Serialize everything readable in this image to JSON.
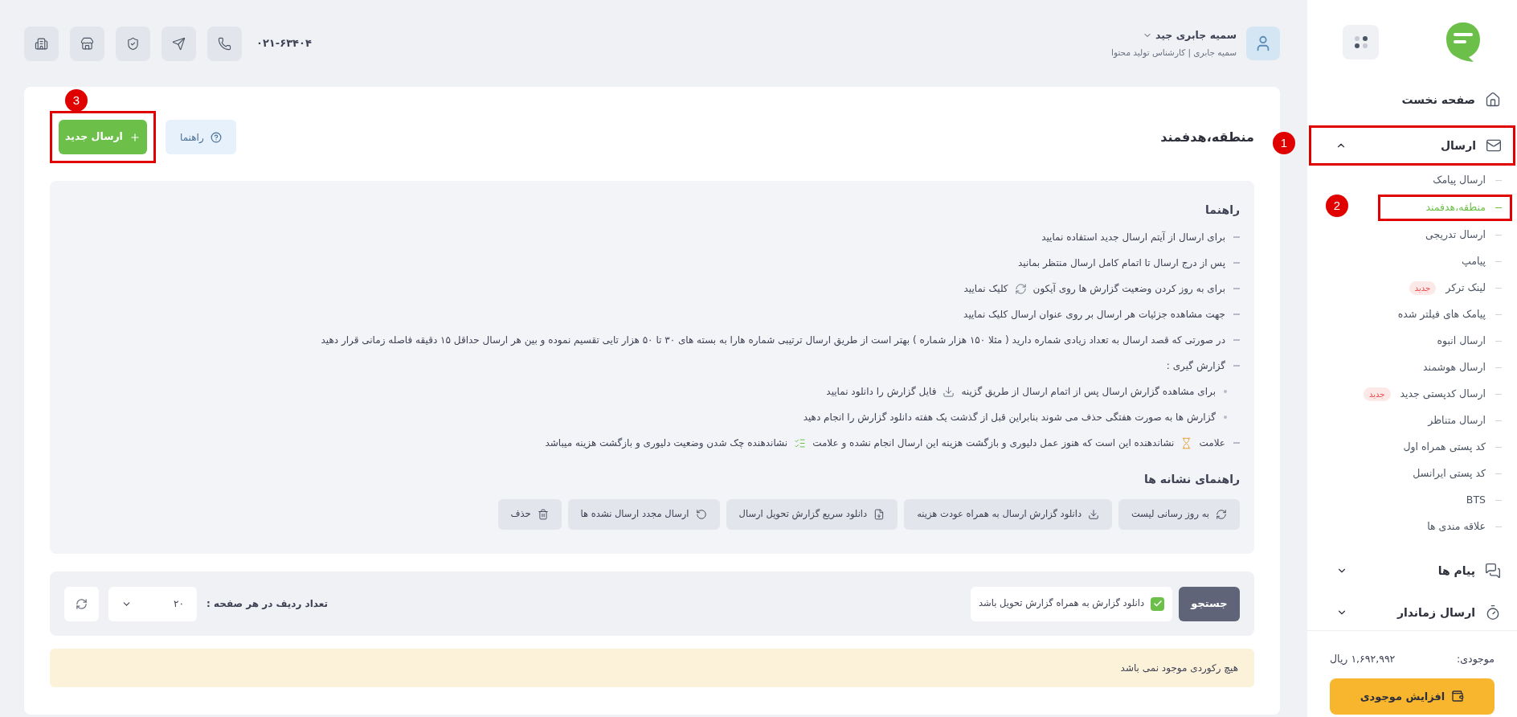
{
  "header": {
    "user": {
      "name": "سمیه جابری جید",
      "subtitle": "سمیه جابری | کارشناس تولید محتوا"
    },
    "phone": "۰۲۱-۶۳۴۰۴",
    "tools": [
      {
        "kind": "phone"
      },
      {
        "kind": "send"
      },
      {
        "kind": "shield"
      },
      {
        "kind": "store"
      },
      {
        "kind": "building"
      }
    ]
  },
  "page": {
    "title": "منطقه،هدفمند",
    "help_button": "راهنما",
    "new_button": {
      "label": "ارسال جدید",
      "annotation": "3"
    }
  },
  "guide": {
    "title": "راهنما",
    "items": [
      {
        "parts": [
          {
            "text": "برای ارسال از آیتم ارسال جدید استفاده نمایید"
          }
        ]
      },
      {
        "parts": [
          {
            "text": "پس از درج ارسال تا اتمام کامل ارسال منتظر بمانید"
          }
        ]
      },
      {
        "parts": [
          {
            "text": "برای به روز کردن وضعیت گزارش ها روی آیکون"
          },
          {
            "kind": "refresh"
          },
          {
            "text": "کلیک نمایید"
          }
        ]
      },
      {
        "parts": [
          {
            "text": "جهت مشاهده جزئیات هر ارسال بر روی عنوان ارسال کلیک نمایید"
          }
        ]
      },
      {
        "parts": [
          {
            "text": "در صورتی که قصد ارسال به تعداد زیادی شماره دارید ( مثلا ۱۵۰ هزار شماره ) بهتر است  از طریق ارسال ترتیبی شماره هارا به بسته های ۳۰ تا ۵۰ هزار تایی تقسیم نموده و بین هر ارسال حداقل ۱۵ دقیقه فاصله زمانی قرار دهید"
          }
        ]
      },
      {
        "parts": [
          {
            "text": "گزارش گیری :"
          }
        ],
        "children": [
          {
            "parts": [
              {
                "text": "برای مشاهده گزارش ارسال پس از اتمام ارسال از طریق گزینه"
              },
              {
                "kind": "download"
              },
              {
                "text": "فایل گزارش را دانلود نمایید"
              }
            ]
          },
          {
            "parts": [
              {
                "text": "گزارش ها به صورت هفتگی حذف می شوند بنابراین قبل از گذشت یک هفته دانلود گزارش را انجام دهید"
              }
            ]
          }
        ]
      },
      {
        "parts": [
          {
            "text": "علامت"
          },
          {
            "kind": "hourglass"
          },
          {
            "text": "نشاندهنده این است که هنوز عمل دلیوری و بازگشت هزینه این ارسال انجام نشده و علامت"
          },
          {
            "kind": "checklist"
          },
          {
            "text": "نشاندهنده چک شدن وضعیت دلیوری و بازگشت هزینه میباشد"
          }
        ]
      }
    ],
    "legend_title": "راهنمای نشانه ها",
    "legend": [
      {
        "kind": "refresh",
        "label": "به روز رسانی لیست"
      },
      {
        "kind": "download",
        "label": "دانلود گزارش ارسال به همراه عودت هزینه"
      },
      {
        "kind": "filedown",
        "label": "دانلود سریع گزارش تحویل ارسال"
      },
      {
        "kind": "retry",
        "label": "ارسال مجدد ارسال نشده ها"
      },
      {
        "kind": "trash",
        "label": "حذف"
      }
    ]
  },
  "filter": {
    "search_button": "جستجو",
    "checkbox": {
      "label": "دانلود گزارش به همراه گزارش تحویل باشد",
      "checked": true
    },
    "rows_label": "تعداد ردیف در هر صفحه :",
    "rows_value": "۲۰"
  },
  "alert": "هیچ رکوردی موجود نمی باشد",
  "sidebar": {
    "items": [
      {
        "kind": "home",
        "label": "صفحه نخست"
      },
      {
        "kind": "mail",
        "label": "ارسال",
        "expanded": true,
        "annotation": "1",
        "children": [
          {
            "label": "ارسال پیامک",
            "selected": false
          },
          {
            "label": "منطقه،هدفمند",
            "selected": true,
            "annotation": "2"
          },
          {
            "label": "ارسال تدریجی",
            "selected": false
          },
          {
            "label": "پیامپ",
            "selected": false
          },
          {
            "label": "لینک ترکر",
            "selected": false,
            "badge": "جدید"
          },
          {
            "label": "پیامک های فیلتر شده",
            "selected": false
          },
          {
            "label": "ارسال انبوه",
            "selected": false
          },
          {
            "label": "ارسال هوشمند",
            "selected": false
          },
          {
            "label": "ارسال کدپستی جدید",
            "selected": false,
            "badge": "جدید"
          },
          {
            "label": "ارسال متناظر",
            "selected": false
          },
          {
            "label": "کد پستی همراه اول",
            "selected": false
          },
          {
            "label": "کد پستی ایرانسل",
            "selected": false
          },
          {
            "label": "BTS",
            "selected": false
          },
          {
            "label": "علاقه مندی ها",
            "selected": false
          }
        ]
      },
      {
        "kind": "messages",
        "label": "پیام ها",
        "expanded": false
      },
      {
        "kind": "timer",
        "label": "ارسال زماندار",
        "expanded": false
      }
    ],
    "balance_label": "موجودی:",
    "balance_value": "۱,۶۹۲,۹۹۲ ریال",
    "topup_button": "افزایش موجودی"
  }
}
